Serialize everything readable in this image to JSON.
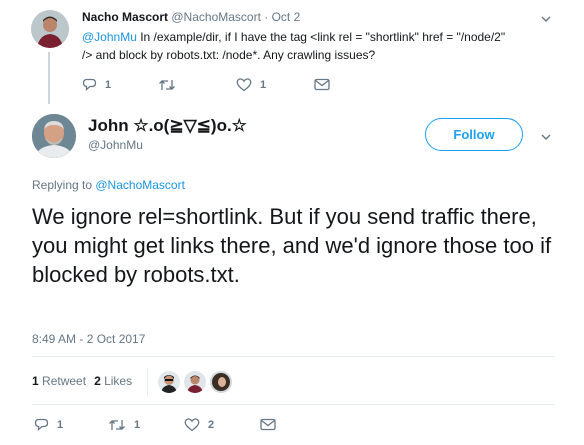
{
  "parent": {
    "name": "Nacho Mascort",
    "handle": "@NachoMascort",
    "date": "· Oct 2",
    "mention": "@JohnMu",
    "text_line1": " In /example/dir, if I have the tag <link rel = \"shortlink\" href = \"/node/2\"",
    "text_line2": "/> and block by robots.txt: /node*. Any crawling issues?",
    "reply_count": "1",
    "like_count": "1"
  },
  "tweet": {
    "author_name": "John ☆.o(≧▽≦)o.☆",
    "author_handle": "@JohnMu",
    "follow_label": "Follow",
    "replying_prefix": "Replying to ",
    "replying_to": "@NachoMascort",
    "text": "We ignore rel=shortlink. But if you send traffic there, you might get links there, and we'd ignore those too if blocked by robots.txt.",
    "timestamp": "8:49 AM - 2 Oct 2017",
    "retweets_count": "1",
    "retweets_label": "Retweet",
    "likes_count": "2",
    "likes_label": "Likes",
    "reply_count": "1",
    "retweet_action_count": "1",
    "like_action_count": "2"
  },
  "icons": [
    "chevron-down-icon",
    "reply-icon",
    "retweet-icon",
    "heart-icon",
    "direct-message-icon"
  ],
  "colors": {
    "accent": "#1da1f2",
    "link": "#1b95e0",
    "muted": "#657786",
    "text": "#14171a",
    "divider": "#e6ecf0"
  }
}
